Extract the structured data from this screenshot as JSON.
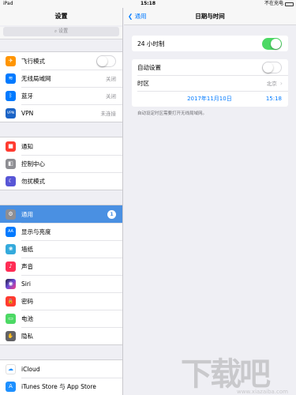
{
  "statusbar": {
    "device": "iPad",
    "time": "15:18",
    "charge": "不在充电"
  },
  "sidebar": {
    "title": "设置",
    "search_placeholder": "设置",
    "group1": [
      {
        "label": "飞行模式",
        "icon": "airplane-icon",
        "color": "#ff9500",
        "glyph": "✈",
        "toggle": "off"
      },
      {
        "label": "无线局域网",
        "icon": "wifi-icon",
        "color": "#007aff",
        "glyph": "≋",
        "value": "关闭"
      },
      {
        "label": "蓝牙",
        "icon": "bluetooth-icon",
        "color": "#007aff",
        "glyph": "ᛒ",
        "value": "关闭"
      },
      {
        "label": "VPN",
        "icon": "vpn-icon",
        "color": "#1a63c6",
        "glyph": "VPN",
        "value": "未连接"
      }
    ],
    "group2": [
      {
        "label": "通知",
        "icon": "notifications-icon",
        "color": "#ff3b30",
        "glyph": "■"
      },
      {
        "label": "控制中心",
        "icon": "control-center-icon",
        "color": "#8e8e93",
        "glyph": "◧"
      },
      {
        "label": "勿扰模式",
        "icon": "do-not-disturb-icon",
        "color": "#5856d6",
        "glyph": "☾"
      }
    ],
    "group3": [
      {
        "label": "通用",
        "icon": "general-gear-icon",
        "color": "#8e8e93",
        "glyph": "⚙",
        "badge": "1",
        "selected": true
      },
      {
        "label": "显示与亮度",
        "icon": "display-brightness-icon",
        "color": "#007aff",
        "glyph": "AA"
      },
      {
        "label": "墙纸",
        "icon": "wallpaper-icon",
        "color": "#34aadc",
        "glyph": "❀"
      },
      {
        "label": "声音",
        "icon": "sounds-icon",
        "color": "#ff2d55",
        "glyph": "♪"
      },
      {
        "label": "Siri",
        "icon": "siri-icon",
        "color": "#222244",
        "glyph": "◉"
      },
      {
        "label": "密码",
        "icon": "passcode-icon",
        "color": "#ff3b30",
        "glyph": "🔒"
      },
      {
        "label": "电池",
        "icon": "battery-icon",
        "color": "#4cd964",
        "glyph": "▭"
      },
      {
        "label": "隐私",
        "icon": "privacy-hand-icon",
        "color": "#636366",
        "glyph": "✋"
      }
    ],
    "group4": [
      {
        "label": "iCloud",
        "icon": "icloud-icon",
        "color": "#ffffff",
        "glyph": "☁"
      },
      {
        "label": "iTunes Store 与 App Store",
        "icon": "app-store-icon",
        "color": "#1e90ff",
        "glyph": "A"
      }
    ]
  },
  "detail": {
    "back_label": "通用",
    "title": "日期与时间",
    "hour24_label": "24 小时制",
    "hour24_state": "on",
    "auto_label": "自动设置",
    "auto_state": "off",
    "timezone_label": "时区",
    "timezone_value": "北京",
    "date": "2017年11月10日",
    "time": "15:18",
    "footnote": "自动设定时区需要打开无线局域网。"
  },
  "watermark": {
    "big": "下载吧",
    "small": "www.xiazaiba.com"
  }
}
